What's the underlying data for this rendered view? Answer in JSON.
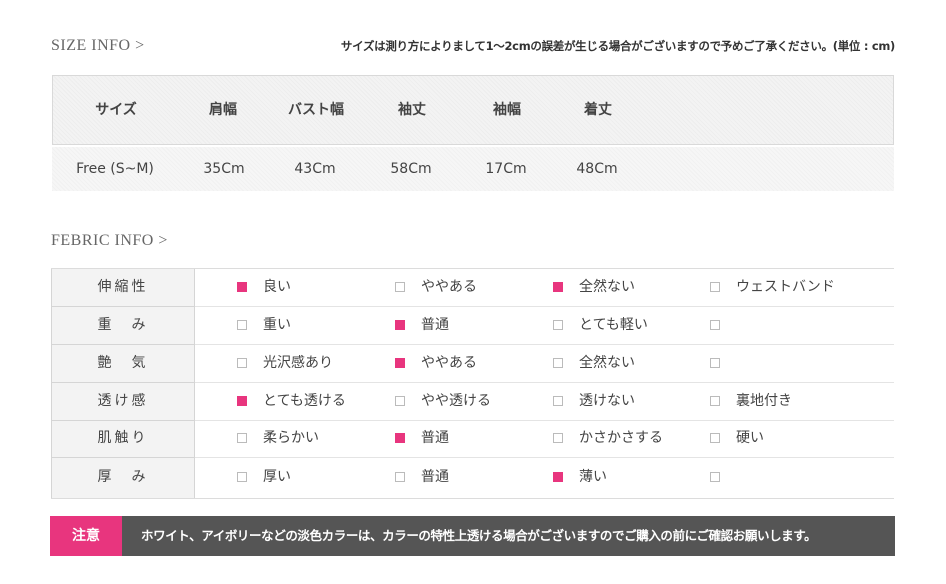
{
  "size_section": {
    "title": "SIZE INFO >",
    "note": "サイズは測り方によりまして1〜2cmの誤差が生じる場合がございますので予めご了承ください。(単位 : cm)",
    "headers": [
      "サイズ",
      "肩幅",
      "バスト幅",
      "袖丈",
      "袖幅",
      "着丈"
    ],
    "values": [
      "Free (S~M)",
      "35Cm",
      "43Cm",
      "58Cm",
      "17Cm",
      "48Cm"
    ]
  },
  "fabric_section": {
    "title": "FEBRIC INFO >",
    "rows": [
      {
        "label": "伸縮性",
        "options": [
          {
            "text": "良い",
            "checked": true
          },
          {
            "text": "ややある",
            "checked": false
          },
          {
            "text": "全然ない",
            "checked": true
          },
          {
            "text": "ウェストバンド",
            "checked": false
          }
        ]
      },
      {
        "label": "重　み",
        "options": [
          {
            "text": "重い",
            "checked": false
          },
          {
            "text": "普通",
            "checked": true
          },
          {
            "text": "とても軽い",
            "checked": false
          },
          {
            "text": "",
            "checked": false
          }
        ]
      },
      {
        "label": "艶　気",
        "options": [
          {
            "text": "光沢感あり",
            "checked": false
          },
          {
            "text": "ややある",
            "checked": true
          },
          {
            "text": "全然ない",
            "checked": false
          },
          {
            "text": "",
            "checked": false
          }
        ]
      },
      {
        "label": "透け感",
        "options": [
          {
            "text": "とても透ける",
            "checked": true
          },
          {
            "text": "やや透ける",
            "checked": false
          },
          {
            "text": "透けない",
            "checked": false
          },
          {
            "text": "裏地付き",
            "checked": false
          }
        ]
      },
      {
        "label": "肌触り",
        "options": [
          {
            "text": "柔らかい",
            "checked": false
          },
          {
            "text": "普通",
            "checked": true
          },
          {
            "text": "かさかさする",
            "checked": false
          },
          {
            "text": "硬い",
            "checked": false
          }
        ]
      },
      {
        "label": "厚　み",
        "options": [
          {
            "text": "厚い",
            "checked": false
          },
          {
            "text": "普通",
            "checked": false
          },
          {
            "text": "薄い",
            "checked": true
          },
          {
            "text": "",
            "checked": false
          }
        ]
      }
    ]
  },
  "notice": {
    "tag": "注意",
    "text": "ホワイト、アイボリーなどの淡色カラーは、カラーの特性上透ける場合がございますのでご購入の前にご確認お願いします。"
  },
  "colors": {
    "accent": "#e8357e",
    "notice_bg": "#555555"
  }
}
